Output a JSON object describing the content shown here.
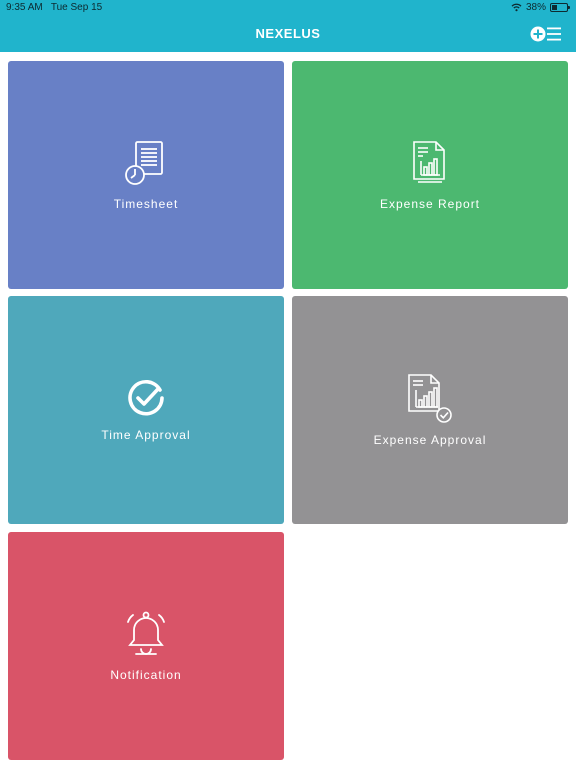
{
  "status_bar": {
    "time": "9:35 AM",
    "date": "Tue Sep 15",
    "battery": "38%",
    "battery_level": 0.38
  },
  "header": {
    "title": "NEXELUS",
    "menu_icon": "add-menu-icon"
  },
  "tiles": [
    {
      "label": "Timesheet",
      "icon": "timesheet-icon",
      "color": "#6880c6"
    },
    {
      "label": "Expense Report",
      "icon": "expense-report-icon",
      "color": "#4cb870"
    },
    {
      "label": "Time Approval",
      "icon": "check-circle-icon",
      "color": "#4fa8bb"
    },
    {
      "label": "Expense Approval",
      "icon": "expense-approval-icon",
      "color": "#939294"
    },
    {
      "label": "Notification",
      "icon": "bell-icon",
      "color": "#d95468"
    }
  ],
  "colors": {
    "header_bg": "#20b4cc"
  }
}
